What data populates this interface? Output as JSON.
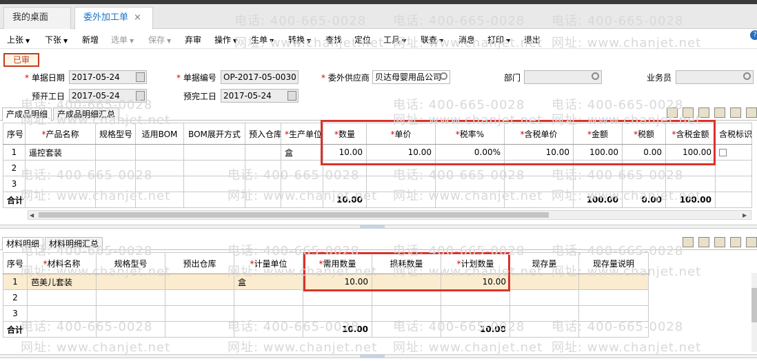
{
  "tabs": [
    {
      "label": "我的桌面"
    },
    {
      "label": "委外加工单",
      "close": "×"
    }
  ],
  "toolbar": [
    {
      "label": "上张",
      "caret": true,
      "disabled": false
    },
    {
      "label": "下张",
      "caret": true,
      "disabled": false
    },
    {
      "label": "新增",
      "caret": false,
      "disabled": false
    },
    {
      "label": "选单",
      "caret": true,
      "disabled": true
    },
    {
      "label": "保存",
      "caret": true,
      "disabled": true
    },
    {
      "label": "弃审",
      "caret": false,
      "disabled": false
    },
    {
      "label": "操作",
      "caret": true,
      "disabled": false
    },
    {
      "label": "生单",
      "caret": true,
      "disabled": false
    },
    {
      "label": "转换",
      "caret": true,
      "disabled": false
    },
    {
      "label": "查找",
      "caret": false,
      "disabled": false
    },
    {
      "label": "定位",
      "caret": false,
      "disabled": false
    },
    {
      "label": "工具",
      "caret": true,
      "disabled": false
    },
    {
      "label": "联查",
      "caret": true,
      "disabled": false
    },
    {
      "label": "消息",
      "caret": false,
      "disabled": false
    },
    {
      "label": "打印",
      "caret": true,
      "disabled": false
    },
    {
      "label": "退出",
      "caret": false,
      "disabled": false
    }
  ],
  "status": "已审",
  "header": {
    "doc_date_label": "单据日期",
    "doc_date": "2017-05-24",
    "doc_no_label": "单据编号",
    "doc_no": "OP-2017-05-0030",
    "supplier_label": "委外供应商",
    "supplier": "贝达母婴用品公司",
    "dept_label": "部门",
    "dept": "",
    "staff_label": "业务员",
    "staff": "",
    "start_label": "预开工日",
    "start": "2017-05-24",
    "finish_label": "预完工日",
    "finish": "2017-05-24"
  },
  "product": {
    "tabs": [
      "产成品明细",
      "产成品明细汇总"
    ],
    "columns": [
      "序号",
      "产品名称",
      "规格型号",
      "适用BOM",
      "BOM展开方式",
      "预入仓库",
      "生产单位",
      "数量",
      "单价",
      "税率%",
      "含税单价",
      "金额",
      "税额",
      "含税金额",
      "含税标识"
    ],
    "rows": [
      [
        "1",
        "遥控套装",
        "",
        "",
        "",
        "",
        "盒",
        "10.00",
        "10.00",
        "0.00%",
        "10.00",
        "100.00",
        "0.00",
        "100.00",
        ""
      ],
      [
        "2",
        "",
        "",
        "",
        "",
        "",
        "",
        "",
        "",
        "",
        "",
        "",
        "",
        "",
        ""
      ],
      [
        "3",
        "",
        "",
        "",
        "",
        "",
        "",
        "",
        "",
        "",
        "",
        "",
        "",
        "",
        ""
      ]
    ],
    "total": [
      "合计",
      "",
      "",
      "",
      "",
      "",
      "",
      "10.00",
      "",
      "",
      "",
      "100.00",
      "0.00",
      "100.00",
      ""
    ]
  },
  "material": {
    "tabs": [
      "材料明细",
      "材料明细汇总"
    ],
    "columns": [
      "序号",
      "材料名称",
      "规格型号",
      "预出仓库",
      "计量单位",
      "需用数量",
      "损耗数量",
      "计划数量",
      "现存量",
      "现存量说明"
    ],
    "rows": [
      [
        "1",
        "芭美儿套装",
        "",
        "",
        "盒",
        "10.00",
        "",
        "10.00",
        "",
        ""
      ],
      [
        "2",
        "",
        "",
        "",
        "",
        "",
        "",
        "",
        "",
        ""
      ],
      [
        "3",
        "",
        "",
        "",
        "",
        "",
        "",
        "",
        "",
        ""
      ]
    ],
    "total": [
      "合计",
      "",
      "",
      "",
      "",
      "10.00",
      "",
      "10.00",
      "",
      ""
    ]
  },
  "watermark": {
    "phone": "电话: 400-665-0028",
    "site": "网址: www.chanjet.net"
  }
}
